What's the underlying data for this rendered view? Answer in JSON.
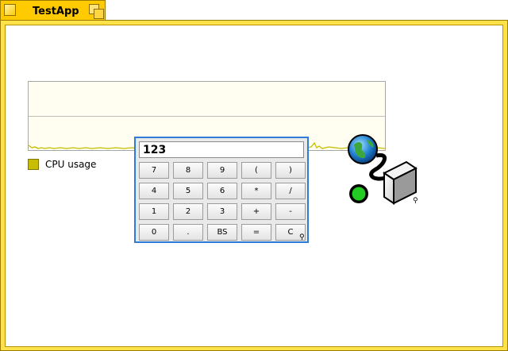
{
  "window": {
    "title": "TestApp"
  },
  "cpu_graph": {
    "legend_label": "CPU usage",
    "legend_color": "#c8bd00",
    "line_color": "#c8bd00"
  },
  "calculator": {
    "display_value": "123",
    "keys": [
      [
        "7",
        "8",
        "9",
        "(",
        ")"
      ],
      [
        "4",
        "5",
        "6",
        "*",
        "/"
      ],
      [
        "1",
        "2",
        "3",
        "+",
        "-"
      ],
      [
        "0",
        ".",
        "BS",
        "=",
        "C"
      ]
    ]
  },
  "icons": {
    "window_close": "close-box-icon",
    "window_zoom": "zoom-box-icon",
    "network": "network-status-icon",
    "replicant_handle": "replicant-handle-icon"
  },
  "colors": {
    "window_accent": "#ffcb00",
    "calc_focus_border": "#2f7bd8",
    "network_status": "#22cc22"
  }
}
